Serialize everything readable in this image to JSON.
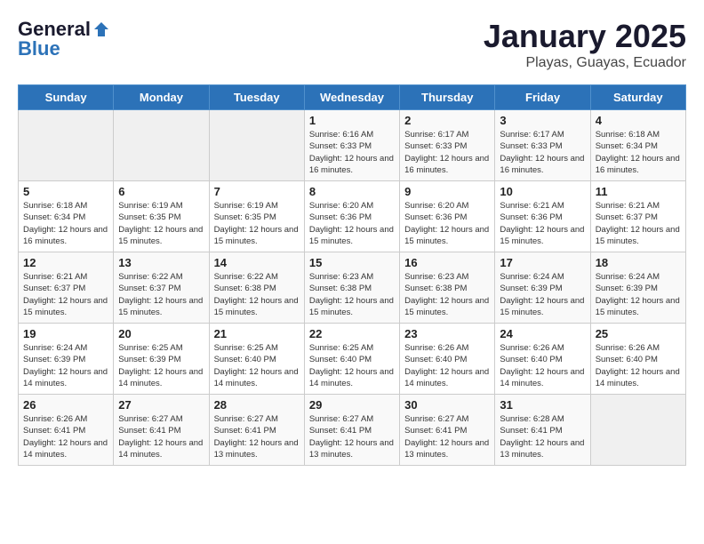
{
  "header": {
    "logo_general": "General",
    "logo_blue": "Blue",
    "month_title": "January 2025",
    "location": "Playas, Guayas, Ecuador"
  },
  "days_of_week": [
    "Sunday",
    "Monday",
    "Tuesday",
    "Wednesday",
    "Thursday",
    "Friday",
    "Saturday"
  ],
  "weeks": [
    [
      {
        "day": "",
        "info": ""
      },
      {
        "day": "",
        "info": ""
      },
      {
        "day": "",
        "info": ""
      },
      {
        "day": "1",
        "info": "Sunrise: 6:16 AM\nSunset: 6:33 PM\nDaylight: 12 hours and 16 minutes."
      },
      {
        "day": "2",
        "info": "Sunrise: 6:17 AM\nSunset: 6:33 PM\nDaylight: 12 hours and 16 minutes."
      },
      {
        "day": "3",
        "info": "Sunrise: 6:17 AM\nSunset: 6:33 PM\nDaylight: 12 hours and 16 minutes."
      },
      {
        "day": "4",
        "info": "Sunrise: 6:18 AM\nSunset: 6:34 PM\nDaylight: 12 hours and 16 minutes."
      }
    ],
    [
      {
        "day": "5",
        "info": "Sunrise: 6:18 AM\nSunset: 6:34 PM\nDaylight: 12 hours and 16 minutes."
      },
      {
        "day": "6",
        "info": "Sunrise: 6:19 AM\nSunset: 6:35 PM\nDaylight: 12 hours and 15 minutes."
      },
      {
        "day": "7",
        "info": "Sunrise: 6:19 AM\nSunset: 6:35 PM\nDaylight: 12 hours and 15 minutes."
      },
      {
        "day": "8",
        "info": "Sunrise: 6:20 AM\nSunset: 6:36 PM\nDaylight: 12 hours and 15 minutes."
      },
      {
        "day": "9",
        "info": "Sunrise: 6:20 AM\nSunset: 6:36 PM\nDaylight: 12 hours and 15 minutes."
      },
      {
        "day": "10",
        "info": "Sunrise: 6:21 AM\nSunset: 6:36 PM\nDaylight: 12 hours and 15 minutes."
      },
      {
        "day": "11",
        "info": "Sunrise: 6:21 AM\nSunset: 6:37 PM\nDaylight: 12 hours and 15 minutes."
      }
    ],
    [
      {
        "day": "12",
        "info": "Sunrise: 6:21 AM\nSunset: 6:37 PM\nDaylight: 12 hours and 15 minutes."
      },
      {
        "day": "13",
        "info": "Sunrise: 6:22 AM\nSunset: 6:37 PM\nDaylight: 12 hours and 15 minutes."
      },
      {
        "day": "14",
        "info": "Sunrise: 6:22 AM\nSunset: 6:38 PM\nDaylight: 12 hours and 15 minutes."
      },
      {
        "day": "15",
        "info": "Sunrise: 6:23 AM\nSunset: 6:38 PM\nDaylight: 12 hours and 15 minutes."
      },
      {
        "day": "16",
        "info": "Sunrise: 6:23 AM\nSunset: 6:38 PM\nDaylight: 12 hours and 15 minutes."
      },
      {
        "day": "17",
        "info": "Sunrise: 6:24 AM\nSunset: 6:39 PM\nDaylight: 12 hours and 15 minutes."
      },
      {
        "day": "18",
        "info": "Sunrise: 6:24 AM\nSunset: 6:39 PM\nDaylight: 12 hours and 15 minutes."
      }
    ],
    [
      {
        "day": "19",
        "info": "Sunrise: 6:24 AM\nSunset: 6:39 PM\nDaylight: 12 hours and 14 minutes."
      },
      {
        "day": "20",
        "info": "Sunrise: 6:25 AM\nSunset: 6:39 PM\nDaylight: 12 hours and 14 minutes."
      },
      {
        "day": "21",
        "info": "Sunrise: 6:25 AM\nSunset: 6:40 PM\nDaylight: 12 hours and 14 minutes."
      },
      {
        "day": "22",
        "info": "Sunrise: 6:25 AM\nSunset: 6:40 PM\nDaylight: 12 hours and 14 minutes."
      },
      {
        "day": "23",
        "info": "Sunrise: 6:26 AM\nSunset: 6:40 PM\nDaylight: 12 hours and 14 minutes."
      },
      {
        "day": "24",
        "info": "Sunrise: 6:26 AM\nSunset: 6:40 PM\nDaylight: 12 hours and 14 minutes."
      },
      {
        "day": "25",
        "info": "Sunrise: 6:26 AM\nSunset: 6:40 PM\nDaylight: 12 hours and 14 minutes."
      }
    ],
    [
      {
        "day": "26",
        "info": "Sunrise: 6:26 AM\nSunset: 6:41 PM\nDaylight: 12 hours and 14 minutes."
      },
      {
        "day": "27",
        "info": "Sunrise: 6:27 AM\nSunset: 6:41 PM\nDaylight: 12 hours and 14 minutes."
      },
      {
        "day": "28",
        "info": "Sunrise: 6:27 AM\nSunset: 6:41 PM\nDaylight: 12 hours and 13 minutes."
      },
      {
        "day": "29",
        "info": "Sunrise: 6:27 AM\nSunset: 6:41 PM\nDaylight: 12 hours and 13 minutes."
      },
      {
        "day": "30",
        "info": "Sunrise: 6:27 AM\nSunset: 6:41 PM\nDaylight: 12 hours and 13 minutes."
      },
      {
        "day": "31",
        "info": "Sunrise: 6:28 AM\nSunset: 6:41 PM\nDaylight: 12 hours and 13 minutes."
      },
      {
        "day": "",
        "info": ""
      }
    ]
  ]
}
